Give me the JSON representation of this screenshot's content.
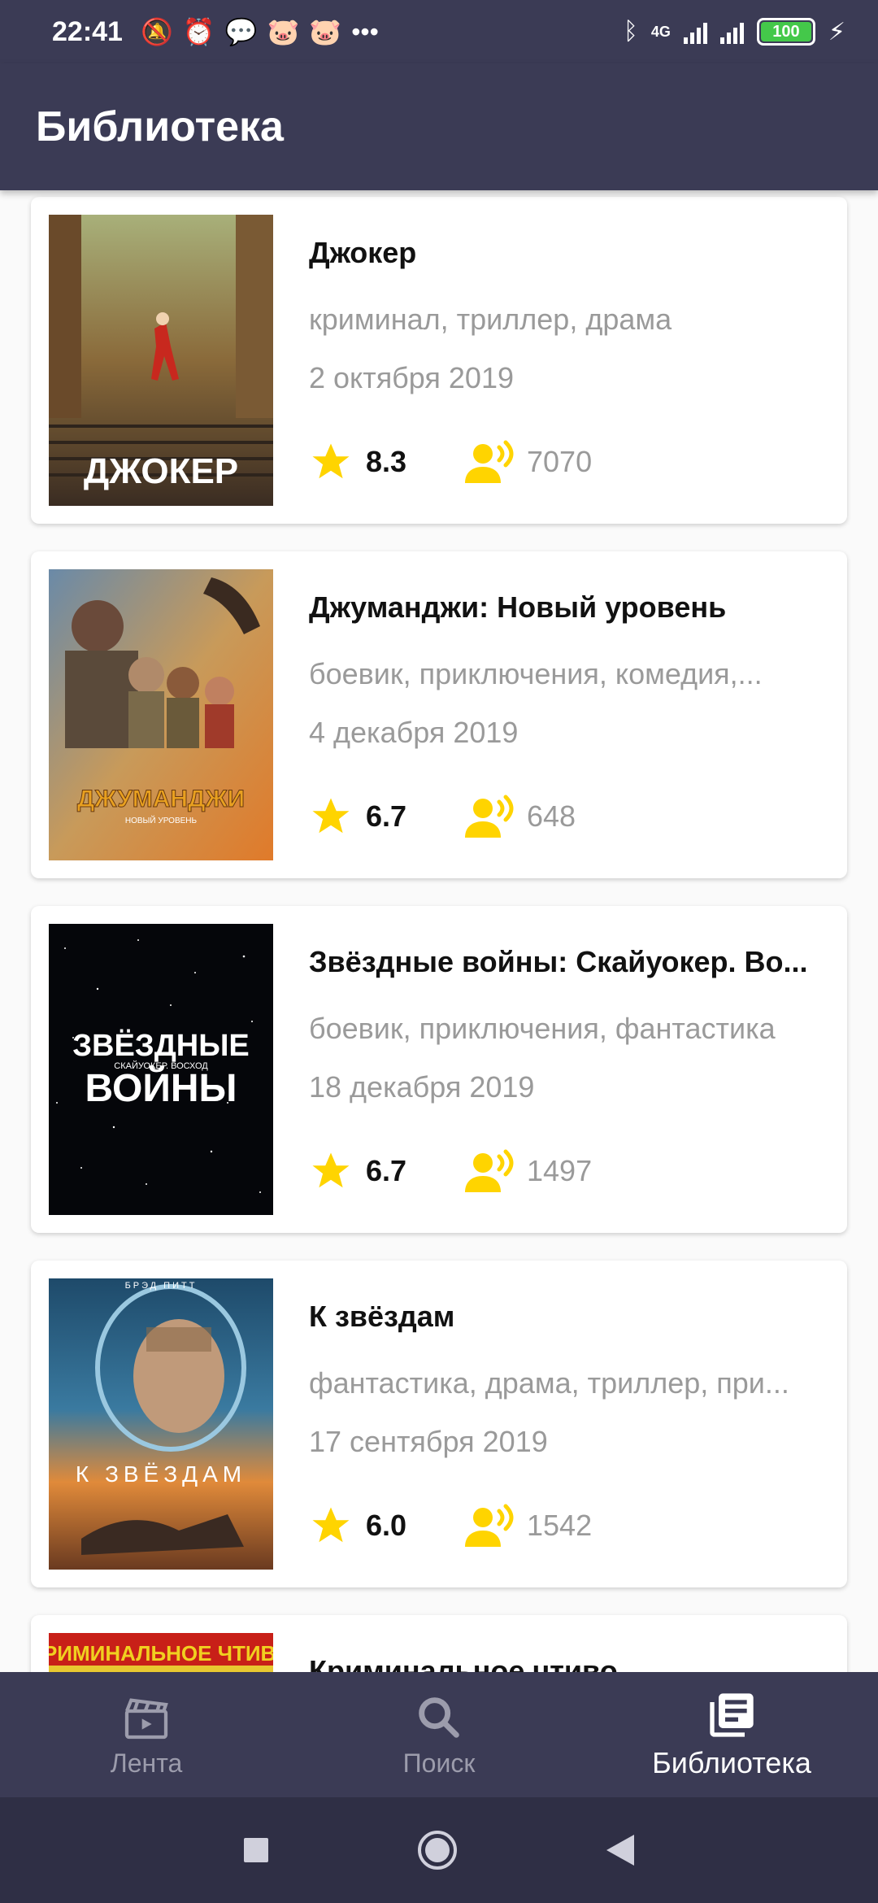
{
  "status": {
    "time": "22:41",
    "battery": "100",
    "network": "4G"
  },
  "app_bar": {
    "title": "Библиотека"
  },
  "movies": [
    {
      "title": "Джокер",
      "genres": "криминал, триллер, драма",
      "date": "2 октября 2019",
      "rating": "8.3",
      "votes": "7070",
      "poster_text": "ДЖОКЕР"
    },
    {
      "title": "Джуманджи: Новый уровень",
      "genres": "боевик, приключения, комедия,...",
      "date": "4 декабря 2019",
      "rating": "6.7",
      "votes": "648",
      "poster_text": "ДЖУМАНДЖИ",
      "poster_sub": "НОВЫЙ УРОВЕНЬ"
    },
    {
      "title": "Звёздные войны: Скайуокер. Во...",
      "genres": "боевик, приключения, фантастика",
      "date": "18 декабря 2019",
      "rating": "6.7",
      "votes": "1497",
      "poster_text_1": "ЗВЁЗДНЫЕ",
      "poster_text_2": "ВОЙНЫ",
      "poster_sub": "СКАЙУОКЕР. ВОСХОД"
    },
    {
      "title": "К звёздам",
      "genres": "фантастика, драма, триллер, при...",
      "date": "17 сентября 2019",
      "rating": "6.0",
      "votes": "1542",
      "poster_text": "К ЗВЁЗДАМ",
      "poster_top": "БРЭД ПИТТ"
    },
    {
      "title": "Криминальное чтиво",
      "poster_text": "КРИМИНАЛЬНОЕ ЧТИВО"
    }
  ],
  "nav": {
    "items": [
      {
        "label": "Лента",
        "icon": "clapperboard-icon"
      },
      {
        "label": "Поиск",
        "icon": "search-icon"
      },
      {
        "label": "Библиотека",
        "icon": "library-icon"
      }
    ]
  },
  "colors": {
    "accent": "#ffd400",
    "bar": "#3b3b55",
    "muted": "#9a9a9a"
  }
}
